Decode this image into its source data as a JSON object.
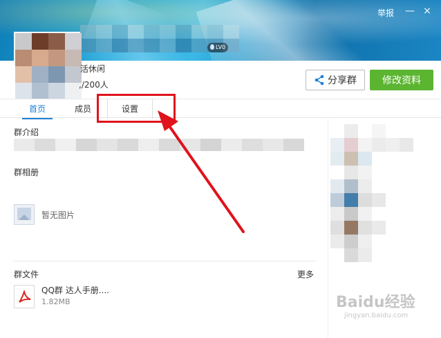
{
  "header": {
    "report_label": "举报",
    "minimize_label": "—",
    "close_label": "×",
    "level_badge": "LV0"
  },
  "group": {
    "category_text": "活休闲",
    "member_count_text": ",/200人"
  },
  "actions": {
    "share_label": "分享群",
    "edit_label": "修改资料"
  },
  "tabs": [
    {
      "label": "首页",
      "active": true
    },
    {
      "label": "成员",
      "active": false
    },
    {
      "label": "设置",
      "active": false
    }
  ],
  "main": {
    "intro_title": "群介绍",
    "album_title": "群相册",
    "no_photo_text": "暂无图片",
    "files_title": "群文件",
    "more_label": "更多",
    "file": {
      "name": "QQ群 达人手册....",
      "size": "1.82MB"
    }
  },
  "watermark": {
    "main": "Baidu经验",
    "sub": "jingyan.baidu.com"
  },
  "colors": {
    "accent_blue": "#1e7fd6",
    "primary_green": "#5cb531",
    "annotation_red": "#e0121b"
  }
}
